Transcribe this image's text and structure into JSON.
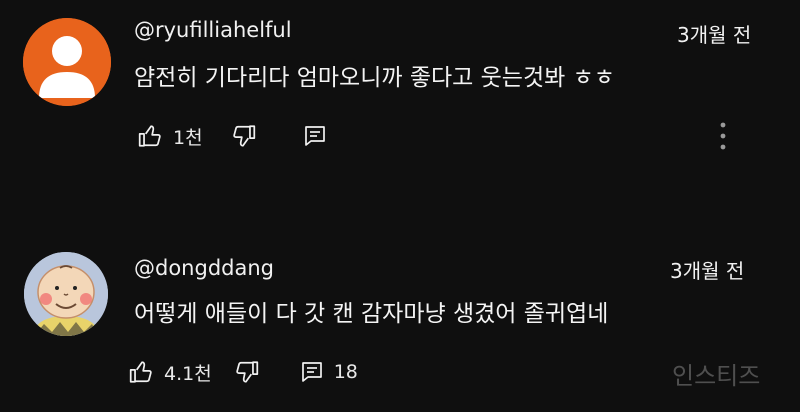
{
  "comments": [
    {
      "username": "@ryufilliahelful",
      "time": "3개월 전",
      "text": "얌전히 기다리다 엄마오니까 좋다고 웃는것봐 ㅎㅎ",
      "likes": "1천",
      "avatar_color": "#e8631c",
      "avatar_icon": "default-user-icon"
    },
    {
      "username": "@dongddang",
      "time": "3개월 전",
      "text": "어떻게 애들이 다 갓 캔 감자마냥 생겼어 졸귀엽네",
      "likes": "4.1천",
      "replies": "18",
      "avatar_color": "#b9c6dc",
      "avatar_icon": "charlie-brown-avatar"
    }
  ],
  "watermark": "인스티즈"
}
